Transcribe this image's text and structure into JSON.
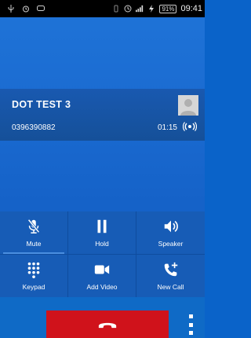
{
  "status_bar": {
    "battery": "91%",
    "time": "09:41"
  },
  "call": {
    "caller_name": "DOT TEST 3",
    "caller_number": "0396390882",
    "timer": "01:15"
  },
  "controls": [
    {
      "label": "Mute",
      "icon": "mic-off-icon"
    },
    {
      "label": "Hold",
      "icon": "pause-icon"
    },
    {
      "label": "Speaker",
      "icon": "speaker-icon"
    },
    {
      "label": "Keypad",
      "icon": "keypad-icon"
    },
    {
      "label": "Add Video",
      "icon": "video-camera-icon"
    },
    {
      "label": "New Call",
      "icon": "add-call-icon"
    }
  ],
  "colors": {
    "end_call": "#d0121b",
    "background": "#1a6ad0"
  }
}
